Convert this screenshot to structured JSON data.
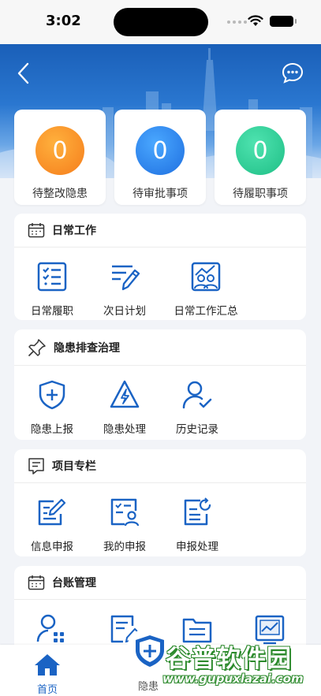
{
  "status_bar": {
    "time": "3:02"
  },
  "header": {
    "back_icon": "chevron-left-icon",
    "message_icon": "chat-bubble-icon"
  },
  "stats": [
    {
      "value": "0",
      "label": "待整改隐患",
      "color": "#f7891f"
    },
    {
      "value": "0",
      "label": "待审批事项",
      "color": "#2a7fee"
    },
    {
      "value": "0",
      "label": "待履职事项",
      "color": "#26cc93"
    }
  ],
  "sections": {
    "daily": {
      "title": "日常工作",
      "items": [
        {
          "label": "日常履职",
          "icon": "checklist-icon"
        },
        {
          "label": "次日计划",
          "icon": "pen-notes-icon"
        },
        {
          "label": "日常工作汇总",
          "icon": "team-chart-icon"
        }
      ]
    },
    "hazard": {
      "title": "隐患排查治理",
      "items": [
        {
          "label": "隐患上报",
          "icon": "shield-plus-icon"
        },
        {
          "label": "隐患处理",
          "icon": "warning-bolt-icon"
        },
        {
          "label": "历史记录",
          "icon": "user-check-icon"
        }
      ]
    },
    "project": {
      "title": "项目专栏",
      "items": [
        {
          "label": "信息申报",
          "icon": "edit-doc-icon"
        },
        {
          "label": "我的申报",
          "icon": "doc-user-icon"
        },
        {
          "label": "申报处理",
          "icon": "doc-refresh-icon"
        }
      ]
    },
    "ledger": {
      "title": "台账管理",
      "items": [
        {
          "icon": "user-grid-icon"
        },
        {
          "icon": "doc-list-icon"
        },
        {
          "icon": "folder-list-icon"
        },
        {
          "icon": "chart-board-icon"
        }
      ]
    }
  },
  "tabbar": {
    "home_label": "首页",
    "hazard_label": "隐患"
  },
  "watermark": {
    "cn": "谷普软件园",
    "url": "www.gupuxlazai.com"
  },
  "colors": {
    "brand": "#1a63c4",
    "accent_orange": "#f7891f",
    "accent_green": "#26cc93"
  }
}
